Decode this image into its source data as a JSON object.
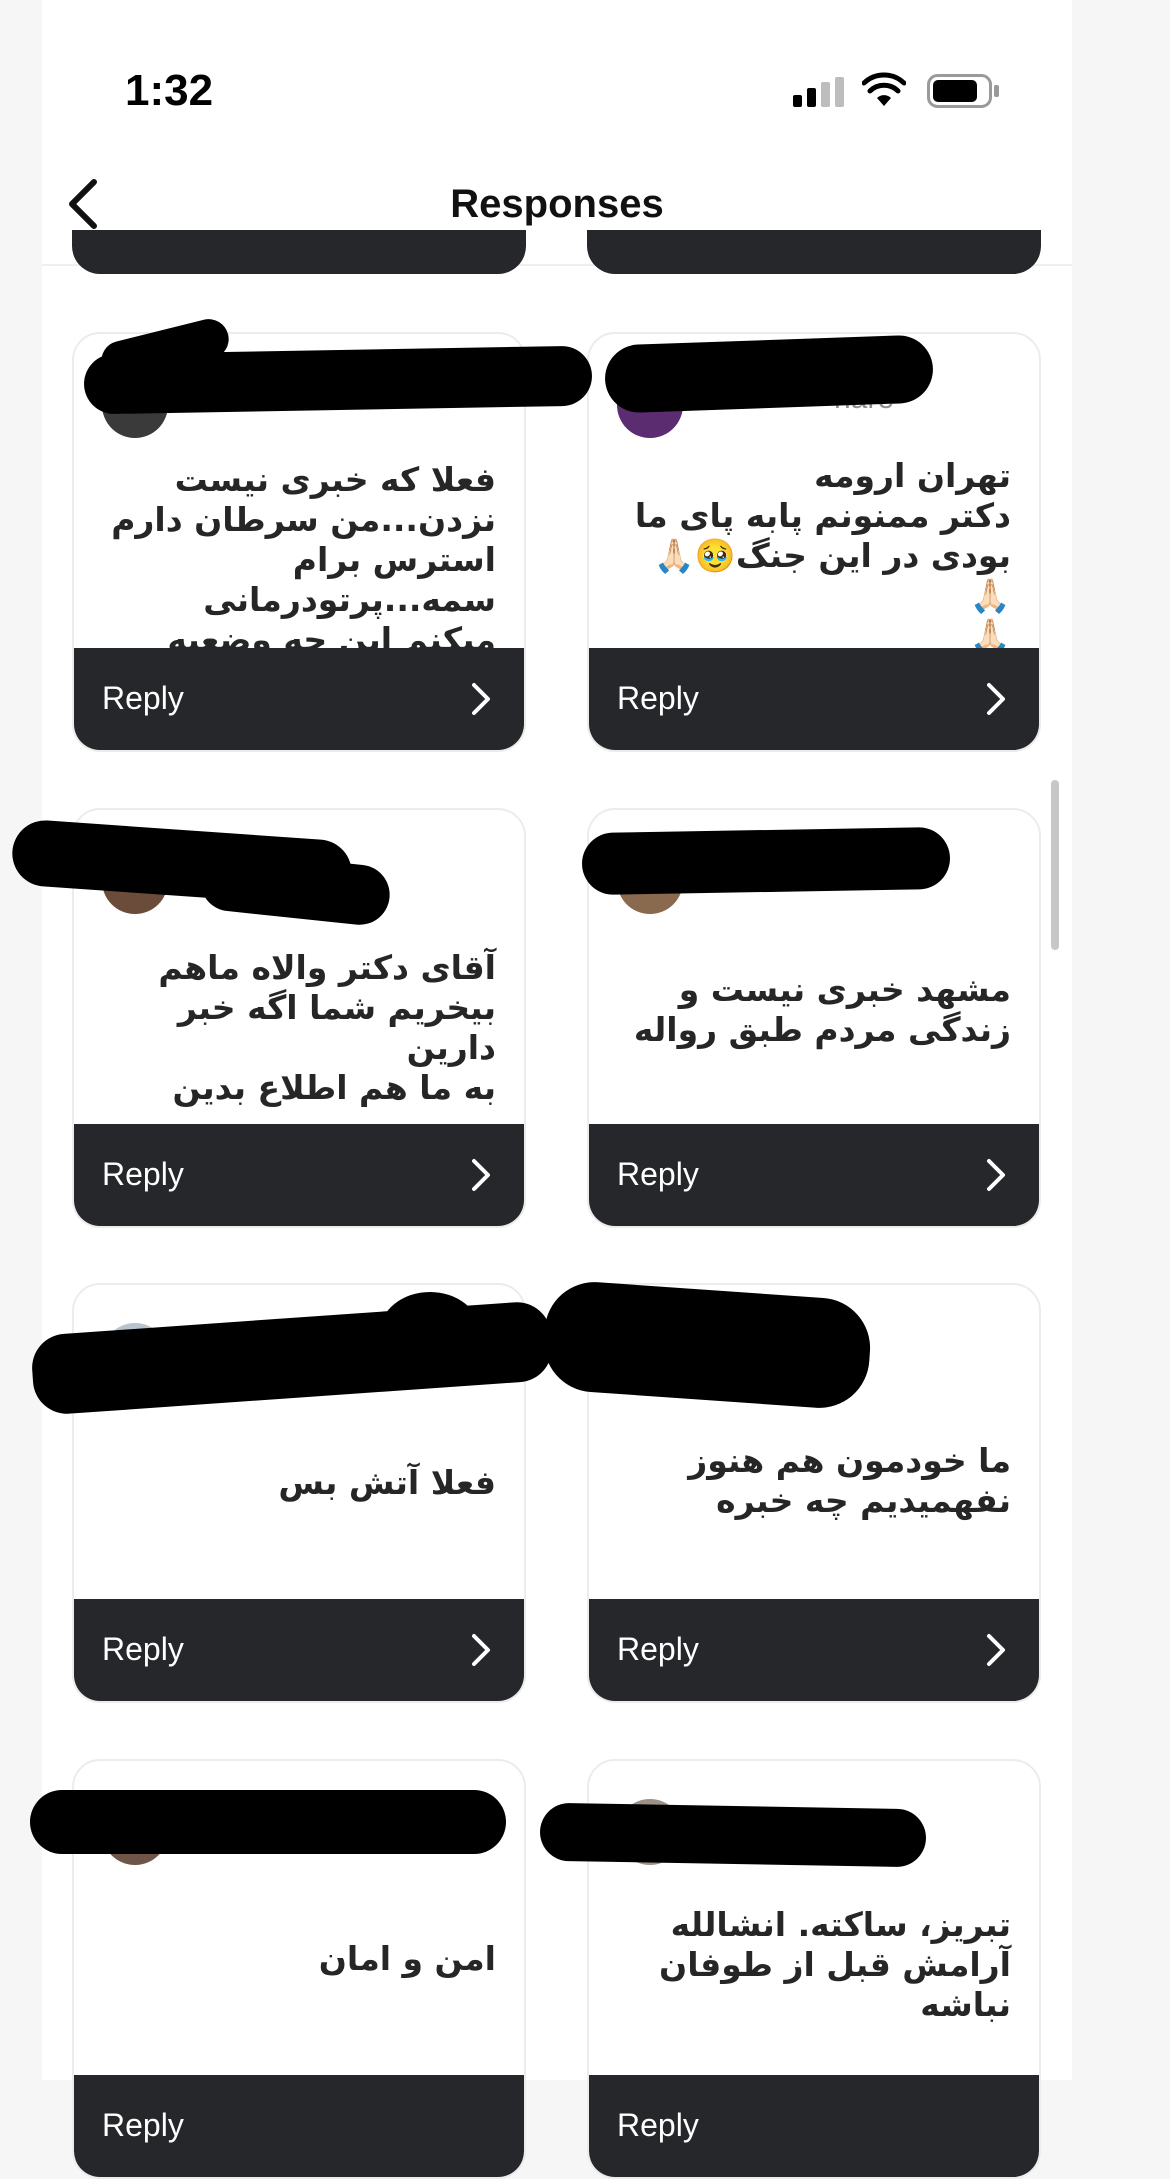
{
  "status_bar": {
    "time": "1:32",
    "signal_icon": "cellular-signal-icon",
    "wifi_icon": "wifi-icon",
    "battery_icon": "battery-icon"
  },
  "header": {
    "title": "Responses",
    "back_icon": "chevron-left-icon"
  },
  "reply_label": "Reply",
  "cards": [
    {
      "username": "",
      "message": "فعلا که خبری نیست\nنزدن...من سرطان دارم\nاسترس برام سمه...پرتودرمانی\nمیکنم این چه وضعیه آخه 😭",
      "reply_label": "Reply"
    },
    {
      "username": "nare",
      "message": "تهران ارومه\nدکتر ممنونم پابه پای ما\nبودی در این جنگ🥹🙏🏻🙏🏻\n🙏🏻",
      "reply_label": "Reply"
    },
    {
      "username": "",
      "message": "آقای دکتر والاه ماهم\nبیخریم شما اگه خبر دارین\nبه ما هم اطلاع بدین",
      "reply_label": "Reply"
    },
    {
      "username": "",
      "message": "مشهد خبری نیست و\nزندگی مردم طبق رواله",
      "reply_label": "Reply"
    },
    {
      "username": "",
      "message": "فعلا آتش بس",
      "reply_label": "Reply"
    },
    {
      "username": "",
      "message": "ما خودمون هم هنوز\nنفهمیدیم چه خبره",
      "reply_label": "Reply"
    },
    {
      "username": "",
      "message": "امن و امان",
      "reply_label": "Reply"
    },
    {
      "username": "",
      "message": "تبریز، ساکته. انشالله\nآرامش قبل از طوفان\nنباشه",
      "reply_label": "Reply"
    }
  ],
  "colors": {
    "reply_bar": "#25272b",
    "card_border": "#ececec",
    "text": "#262626",
    "redaction": "#000000"
  }
}
